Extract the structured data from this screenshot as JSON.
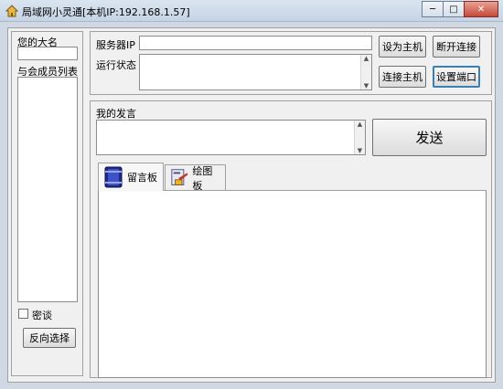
{
  "window": {
    "title": "局域网小灵通[本机IP:192.168.1.57]",
    "minimize_glyph": "─",
    "maximize_glyph": "□",
    "close_glyph": "✕"
  },
  "left": {
    "name_label": "您的大名",
    "name_value": "",
    "members_label": "与会成员列表",
    "members": [],
    "private_chat_label": "密谈",
    "private_chat_checked": false,
    "reverse_select_label": "反向选择"
  },
  "server": {
    "ip_label": "服务器IP",
    "ip_value": "",
    "status_label": "运行状态",
    "status_value": "",
    "set_host_label": "设为主机",
    "disconnect_label": "断开连接",
    "connect_host_label": "连接主机",
    "set_port_label": "设置端口"
  },
  "chat": {
    "my_speech_label": "我的发言",
    "message_value": "",
    "send_label": "发送"
  },
  "tabs": [
    {
      "label": "留言板",
      "icon": "notebook-icon",
      "active": true
    },
    {
      "label": "绘图板",
      "icon": "paint-icon",
      "active": false
    }
  ],
  "colors": {
    "accent_border": "#3c7fb1",
    "close_button": "#c6493a"
  }
}
